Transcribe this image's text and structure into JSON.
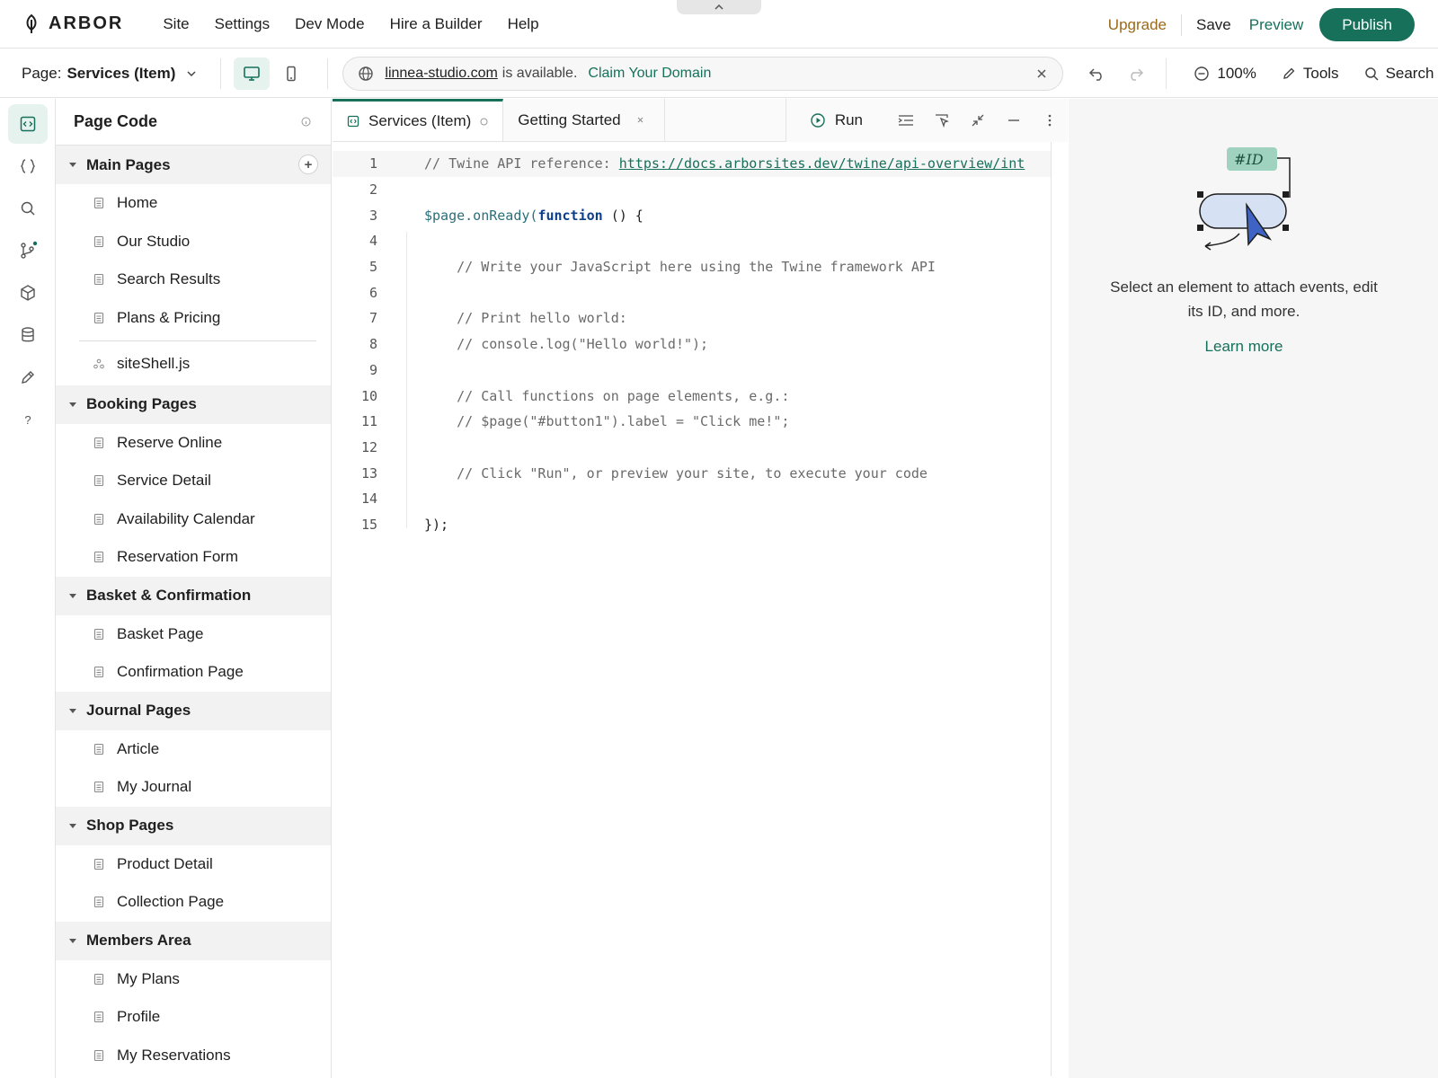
{
  "topbar": {
    "brand": "ARBOR",
    "menu": [
      "Site",
      "Settings",
      "Dev Mode",
      "Hire a Builder",
      "Help"
    ],
    "upgrade": "Upgrade",
    "save": "Save",
    "preview": "Preview",
    "publish": "Publish"
  },
  "subbar": {
    "page_label": "Page:",
    "page_value": "Services (Item)",
    "domain": "linnea-studio.com",
    "domain_text": "is available.",
    "claim": "Claim Your Domain",
    "zoom": "100%",
    "tools": "Tools",
    "search": "Search"
  },
  "sidebar": {
    "title": "Page Code",
    "groups": [
      {
        "name": "Main Pages",
        "items": [
          "Home",
          "Our Studio",
          "Search Results",
          "Plans & Pricing"
        ]
      },
      {
        "name": "Booking Pages",
        "items": [
          "Reserve Online",
          "Service Detail",
          "Availability Calendar",
          "Reservation Form"
        ]
      },
      {
        "name": "Basket & Confirmation",
        "items": [
          "Basket Page",
          "Confirmation Page"
        ]
      },
      {
        "name": "Journal Pages",
        "items": [
          "Article",
          "My Journal"
        ]
      },
      {
        "name": "Shop Pages",
        "items": [
          "Product Detail",
          "Collection Page"
        ]
      },
      {
        "name": "Members Area",
        "items": [
          "My Plans",
          "Profile",
          "My Reservations"
        ]
      }
    ],
    "site_shell": "siteShell.js"
  },
  "editor": {
    "tabs": [
      {
        "label": "Services (Item)"
      },
      {
        "label": "Getting Started"
      }
    ],
    "run": "Run",
    "lines": [
      {
        "n": "1",
        "comment": "// Twine API reference: ",
        "link": "https://docs.arborsites.dev/twine/api-overview/int"
      },
      {
        "n": "2"
      },
      {
        "n": "3",
        "obj": "$page.onReady(",
        "kw": "function",
        "rest": " () {"
      },
      {
        "n": "4"
      },
      {
        "n": "5",
        "comment": "    // Write your JavaScript here using the Twine framework API"
      },
      {
        "n": "6"
      },
      {
        "n": "7",
        "comment": "    // Print hello world:"
      },
      {
        "n": "8",
        "comment": "    // console.log(\"Hello world!\");"
      },
      {
        "n": "9"
      },
      {
        "n": "10",
        "comment": "    // Call functions on page elements, e.g.:"
      },
      {
        "n": "11",
        "comment": "    // $page(\"#button1\").label = \"Click me!\";"
      },
      {
        "n": "12"
      },
      {
        "n": "13",
        "comment": "    // Click \"Run\", or preview your site, to execute your code"
      },
      {
        "n": "14"
      },
      {
        "n": "15",
        "rest": "});"
      }
    ]
  },
  "right_panel": {
    "badge": "#ID",
    "text": "Select an element to attach events, edit its ID, and more.",
    "learn_more": "Learn more"
  },
  "colors": {
    "accent": "#17705a",
    "upgrade": "#9a6a1c"
  }
}
